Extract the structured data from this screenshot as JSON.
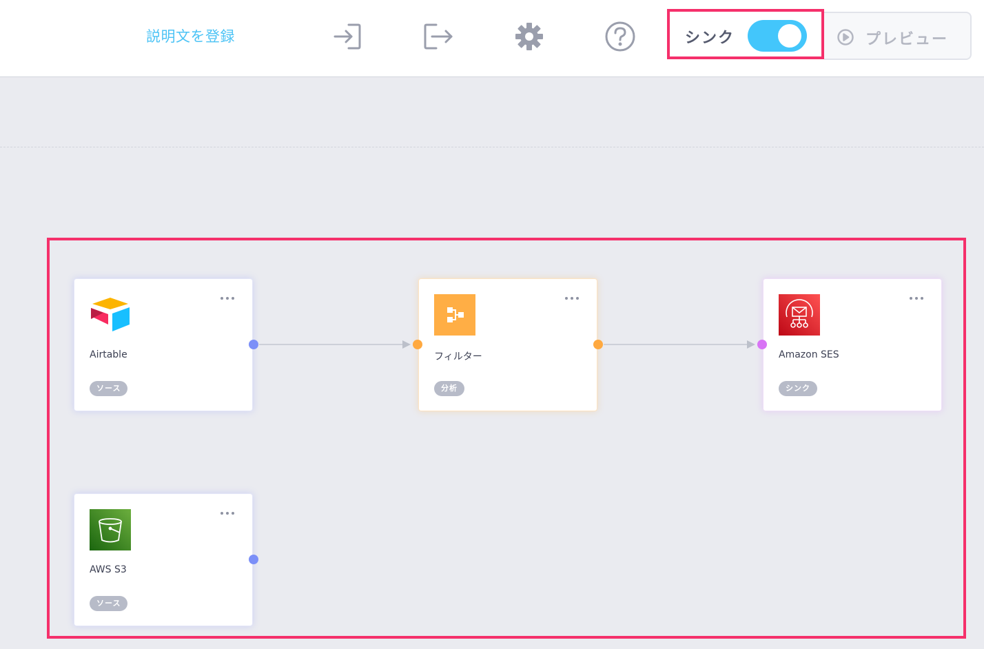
{
  "header": {
    "description_link": "説明文を登録",
    "icons": {
      "import": "import-icon",
      "export": "export-icon",
      "settings": "gear-icon",
      "help": "help-circle-icon"
    },
    "sync": {
      "label": "シンク",
      "toggle_on": true
    },
    "preview": {
      "label": "プレビュー",
      "icon": "play-circle-icon"
    }
  },
  "nodes": [
    {
      "id": "airtable",
      "title": "Airtable",
      "badge": "ソース",
      "icon": "airtable-logo-icon"
    },
    {
      "id": "filter",
      "title": "フィルター",
      "badge": "分析",
      "icon": "filter-flow-icon"
    },
    {
      "id": "amazon-ses",
      "title": "Amazon SES",
      "badge": "シンク",
      "icon": "amazon-ses-icon"
    },
    {
      "id": "aws-s3",
      "title": "AWS S3",
      "badge": "ソース",
      "icon": "s3-bucket-icon"
    }
  ],
  "colors": {
    "accent": "#43c6fb",
    "link": "#4cc3f5",
    "highlight": "#f5306b",
    "source_port": "#7b8ff8",
    "analysis_port": "#ffa940",
    "sink_port": "#d874f5",
    "filter_icon_bg": "#ffae45",
    "ses_icon_bg": "#dd2b2b",
    "s3_icon_bg": "#3f8a24"
  }
}
